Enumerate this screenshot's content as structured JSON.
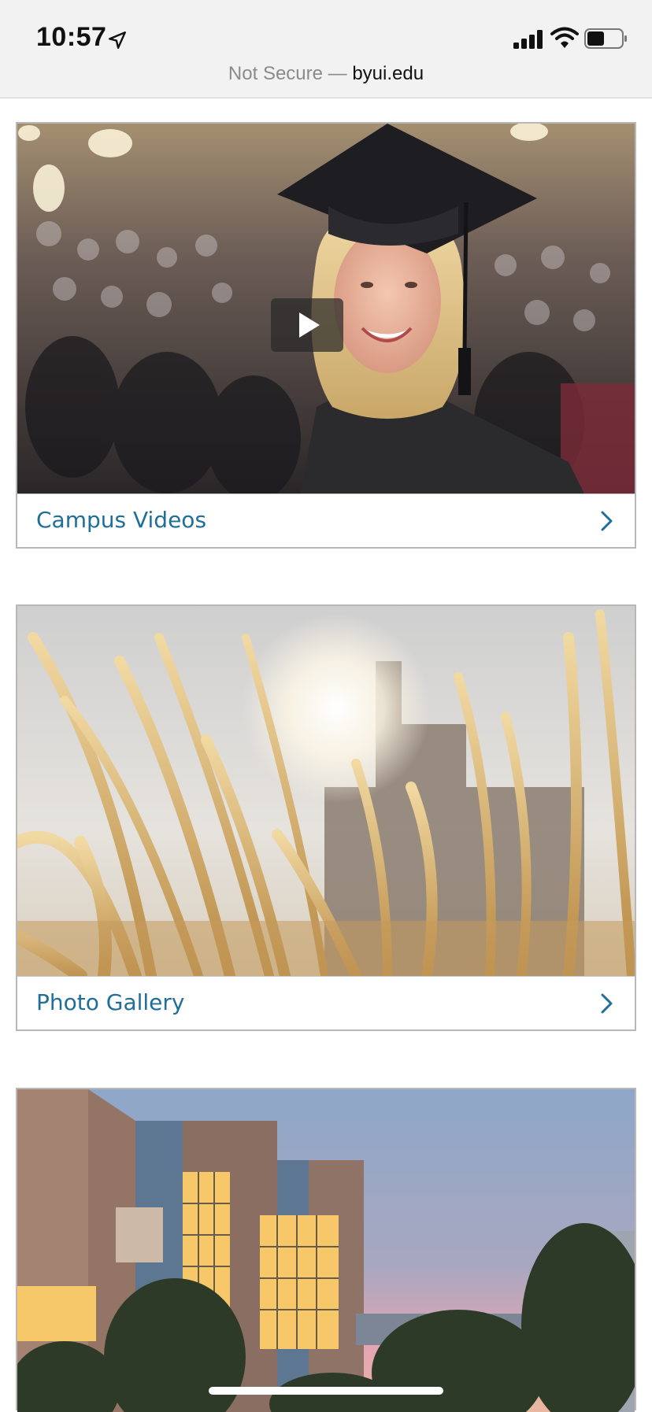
{
  "status_bar": {
    "time": "10:57",
    "location_icon": "location-arrow-icon",
    "signal_icon": "cellular-signal-icon",
    "wifi_icon": "wifi-icon",
    "battery_icon": "battery-icon",
    "battery_level": 0.5
  },
  "address_bar": {
    "security_label": "Not Secure —",
    "domain": "byui.edu"
  },
  "cards": [
    {
      "label": "Campus Videos",
      "icon": "chevron-right-icon",
      "media_icon": "play-icon"
    },
    {
      "label": "Photo Gallery",
      "icon": "chevron-right-icon"
    }
  ],
  "colors": {
    "link": "#1f6f99",
    "border": "#b8b8b8",
    "status_bg": "#f2f2f2"
  }
}
